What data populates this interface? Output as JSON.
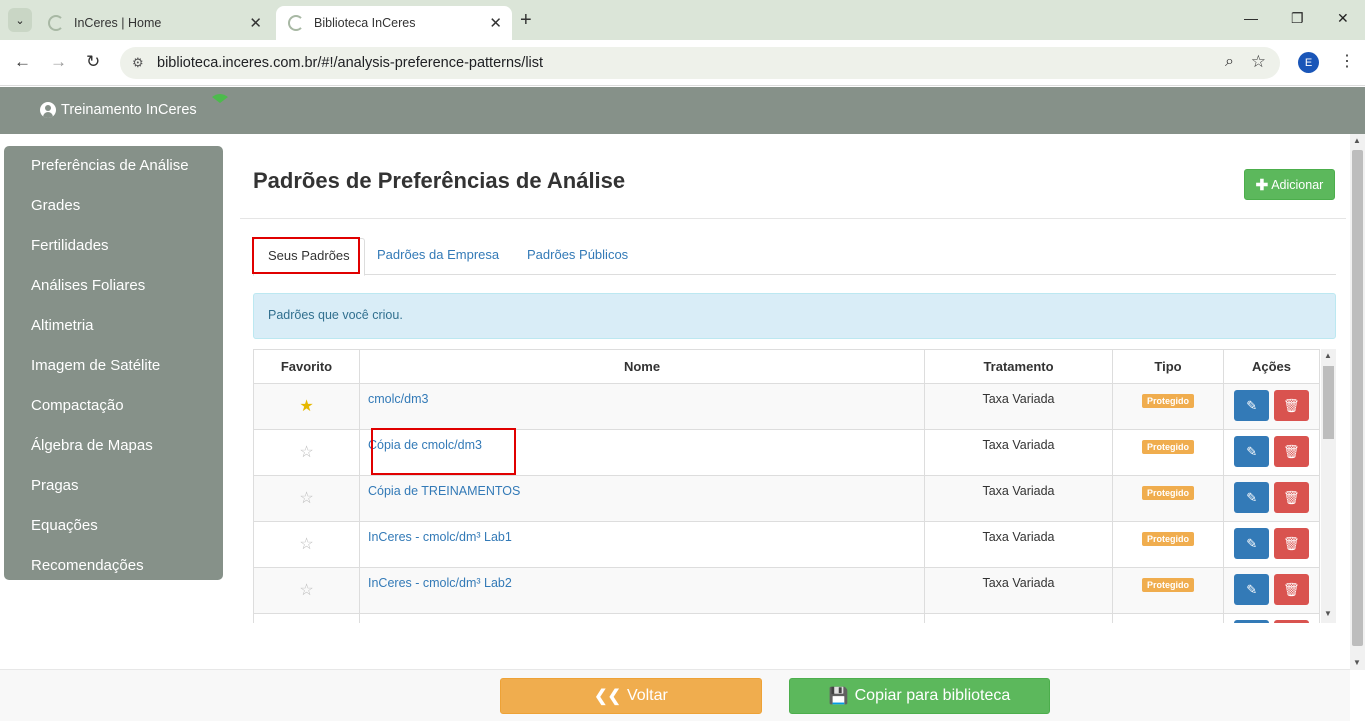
{
  "browser": {
    "tabs": [
      {
        "title": "InCeres | Home"
      },
      {
        "title": "Biblioteca InCeres"
      }
    ],
    "url": "biblioteca.inceres.com.br/#!/analysis-preference-patterns/list",
    "profile_initial": "E"
  },
  "header": {
    "user": "Treinamento InCeres"
  },
  "sidebar": {
    "items": [
      {
        "label": "Preferências de Análise"
      },
      {
        "label": "Grades"
      },
      {
        "label": "Fertilidades"
      },
      {
        "label": "Análises Foliares"
      },
      {
        "label": "Altimetria"
      },
      {
        "label": "Imagem de Satélite"
      },
      {
        "label": "Compactação"
      },
      {
        "label": "Álgebra de Mapas"
      },
      {
        "label": "Pragas"
      },
      {
        "label": "Equações"
      },
      {
        "label": "Recomendações"
      }
    ]
  },
  "main": {
    "title": "Padrões de Preferências de Análise",
    "add_label": "Adicionar",
    "tabs": [
      {
        "label": "Seus Padrões"
      },
      {
        "label": "Padrões da Empresa"
      },
      {
        "label": "Padrões Públicos"
      }
    ],
    "info": "Padrões que você criou.",
    "table": {
      "headers": [
        "Favorito",
        "Nome",
        "Tratamento",
        "Tipo",
        "Ações"
      ],
      "rows": [
        {
          "favorite": true,
          "name": "cmolc/dm3",
          "tratamento": "Taxa Variada",
          "tipo": "Protegido"
        },
        {
          "favorite": false,
          "name": "Cópia de cmolc/dm3",
          "tratamento": "Taxa Variada",
          "tipo": "Protegido"
        },
        {
          "favorite": false,
          "name": "Cópia de TREINAMENTOS",
          "tratamento": "Taxa Variada",
          "tipo": "Protegido"
        },
        {
          "favorite": false,
          "name": "InCeres - cmolc/dm³ Lab1",
          "tratamento": "Taxa Variada",
          "tipo": "Protegido"
        },
        {
          "favorite": false,
          "name": "InCeres - cmolc/dm³ Lab2",
          "tratamento": "Taxa Variada",
          "tipo": "Protegido"
        }
      ]
    }
  },
  "footer": {
    "back_label": "Voltar",
    "copy_label": "Copiar para biblioteca"
  },
  "colors": {
    "accent_green": "#5cb85c",
    "accent_orange": "#f0ad4e",
    "header_gray": "#869189",
    "link_blue": "#337ab7",
    "danger_red": "#d9534f"
  }
}
